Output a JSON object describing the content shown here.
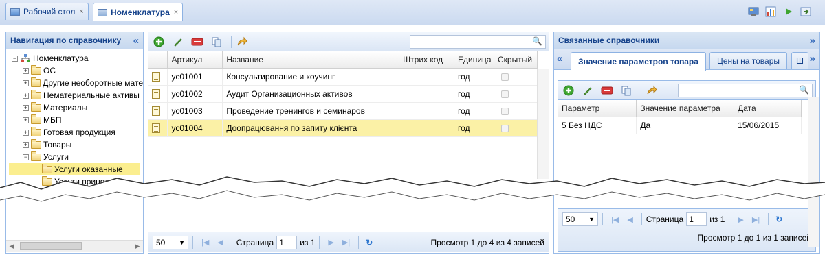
{
  "top_tabs": [
    {
      "label": "Рабочий стол",
      "close": "×"
    },
    {
      "label": "Номенклатура",
      "close": "×"
    }
  ],
  "nav_panel": {
    "title": "Навигация по справочнику",
    "collapse": "«",
    "tree": [
      {
        "label": "Номенклатура",
        "depth": 0,
        "toggle": "−"
      },
      {
        "label": "ОС",
        "depth": 1,
        "toggle": "+"
      },
      {
        "label": "Другие необоротные мате",
        "depth": 1,
        "toggle": "+"
      },
      {
        "label": "Нематериальные активы",
        "depth": 1,
        "toggle": "+"
      },
      {
        "label": "Материалы",
        "depth": 1,
        "toggle": "+"
      },
      {
        "label": "МБП",
        "depth": 1,
        "toggle": "+"
      },
      {
        "label": "Готовая продукция",
        "depth": 1,
        "toggle": "+"
      },
      {
        "label": "Товары",
        "depth": 1,
        "toggle": "+"
      },
      {
        "label": "Услуги",
        "depth": 1,
        "toggle": "−"
      },
      {
        "label": "Услуги оказанные",
        "depth": 2,
        "toggle": "",
        "selected": true
      },
      {
        "label": "Услуги принятые",
        "depth": 2,
        "toggle": ""
      }
    ]
  },
  "main_grid": {
    "columns": [
      "Артикул",
      "Название",
      "Штрих код",
      "Единица",
      "Скрытый"
    ],
    "rows": [
      {
        "sku": "ус01001",
        "name": "Консультирование и коучинг",
        "barcode": "",
        "unit": "год",
        "hidden": false
      },
      {
        "sku": "ус01002",
        "name": "Аудит Организационных активов",
        "barcode": "",
        "unit": "год",
        "hidden": false
      },
      {
        "sku": "ус01003",
        "name": "Проведение тренингов и семинаров",
        "barcode": "",
        "unit": "год",
        "hidden": false
      },
      {
        "sku": "ус01004",
        "name": "Доопрацювання по запиту клієнта",
        "barcode": "",
        "unit": "год",
        "hidden": false,
        "selected": true
      }
    ],
    "paging": {
      "page_size": "50",
      "page_label": "Страница",
      "page": "1",
      "of": "из 1",
      "summary": "Просмотр 1 до 4 из 4 записей"
    }
  },
  "related_panel": {
    "title": "Связанные справочники",
    "collapse": "»",
    "scroll_left": "«",
    "scroll_right": "»",
    "tabs": [
      "Значение параметров товара",
      "Цены на товары",
      "Ш"
    ],
    "columns": [
      "Параметр",
      "Значение параметра",
      "Дата"
    ],
    "rows": [
      {
        "param": "5 Без НДС",
        "value": "Да",
        "date": "15/06/2015"
      }
    ],
    "paging": {
      "page_size": "50",
      "page_label": "Страница",
      "page": "1",
      "of": "из 1",
      "summary": "Просмотр 1 до 1 из 1 записей"
    }
  },
  "colors": {
    "accent": "#15428b",
    "border": "#99bbe8",
    "selection": "#fbf1a6"
  }
}
